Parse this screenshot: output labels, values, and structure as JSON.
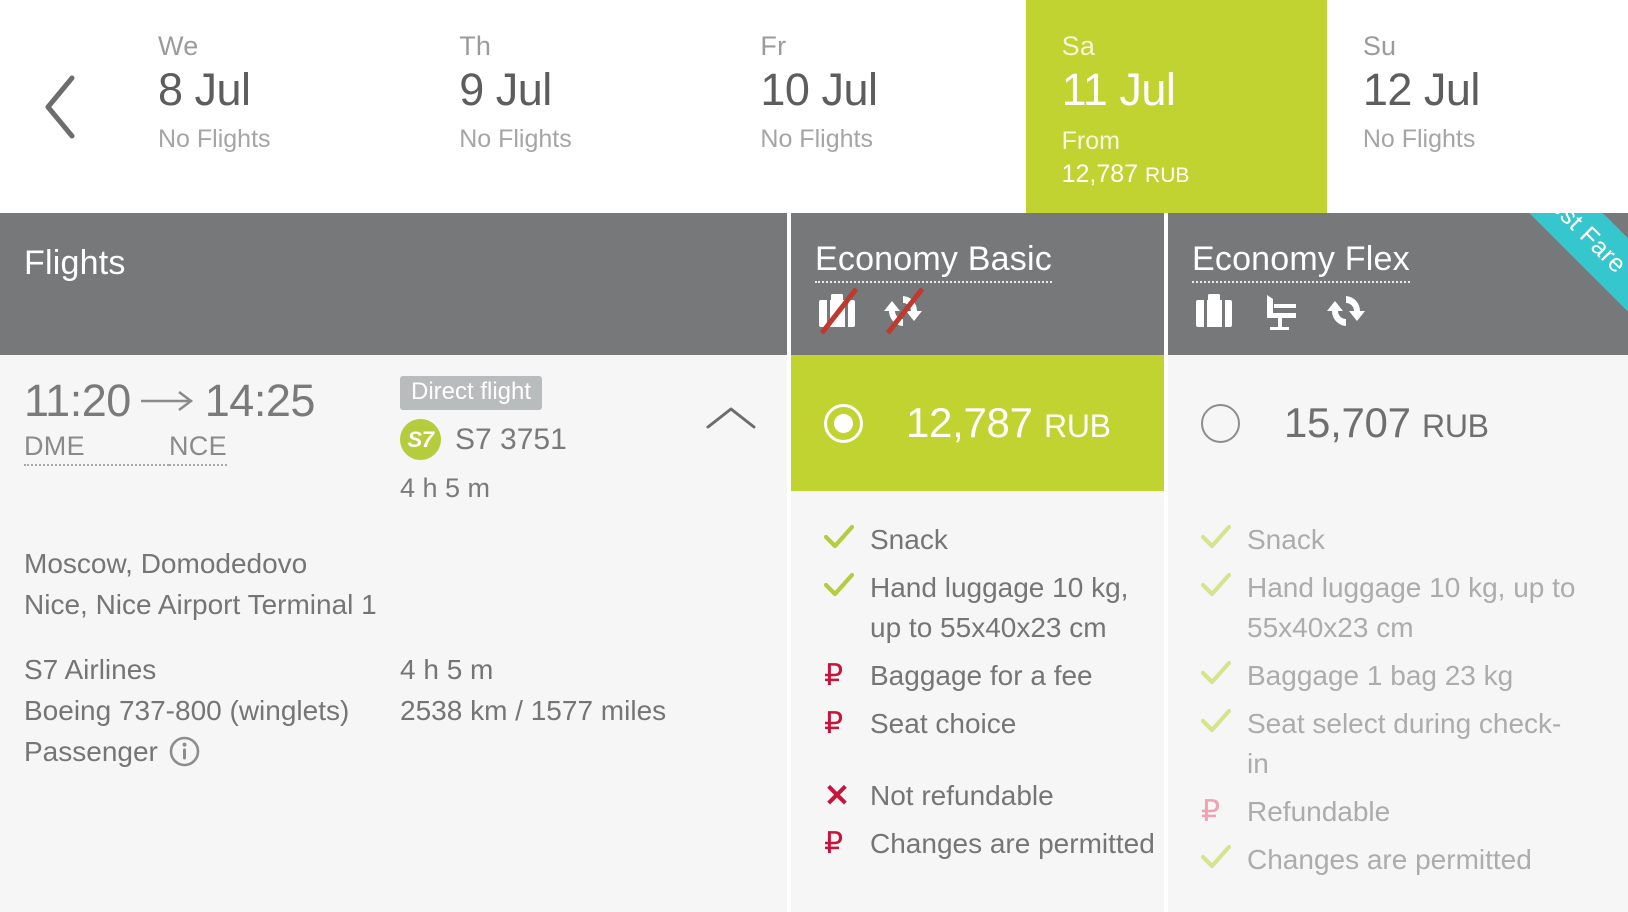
{
  "date_strip": {
    "prev_icon": "chevron-left-icon",
    "days": [
      {
        "dow": "We",
        "date": "8 Jul",
        "status": "No Flights",
        "selected": false
      },
      {
        "dow": "Th",
        "date": "9 Jul",
        "status": "No Flights",
        "selected": false
      },
      {
        "dow": "Fr",
        "date": "10 Jul",
        "status": "No Flights",
        "selected": false
      },
      {
        "dow": "Sa",
        "date": "11 Jul",
        "from_label": "From",
        "price": "12,787",
        "currency": "RUB",
        "selected": true
      },
      {
        "dow": "Su",
        "date": "12 Jul",
        "status": "No Flights",
        "selected": false
      }
    ]
  },
  "table_header": {
    "flights_label": "Flights",
    "fares": [
      {
        "name": "Economy Basic",
        "icons": [
          {
            "name": "suitcase-icon",
            "crossed": true
          },
          {
            "name": "exchange-refresh-icon",
            "crossed": true
          }
        ],
        "ribbon": null
      },
      {
        "name": "Economy Flex",
        "icons": [
          {
            "name": "suitcase-icon",
            "crossed": false
          },
          {
            "name": "seat-icon",
            "crossed": false
          },
          {
            "name": "exchange-refresh-icon",
            "crossed": false
          }
        ],
        "ribbon": "Best Fare"
      }
    ]
  },
  "flight": {
    "depart_time": "11:20",
    "arrive_time": "14:25",
    "depart_code": "DME",
    "arrive_code": "NCE",
    "direct_badge": "Direct flight",
    "carrier_logo_text": "S7",
    "flight_number": "S7 3751",
    "duration_short": "4 h 5 m",
    "collapse_icon": "chevron-up-icon",
    "origin_full": "Moscow, Domodedovo",
    "destination_full": "Nice, Nice Airport Terminal 1",
    "airline": "S7 Airlines",
    "duration": "4 h 5 m",
    "aircraft": "Boeing 737-800 (winglets)",
    "distance": "2538 km / 1577 miles",
    "passenger_label": "Passenger",
    "passenger_info_icon": "info-icon"
  },
  "fare_options": [
    {
      "id": "economy-basic",
      "price": "12,787",
      "currency": "RUB",
      "selected": true,
      "features": [
        {
          "icon": "check",
          "text": "Snack",
          "group": 1
        },
        {
          "icon": "check",
          "text": "Hand luggage 10 kg, up to 55x40x23 cm",
          "group": 1
        },
        {
          "icon": "rub",
          "text": "Baggage for a fee",
          "group": 1
        },
        {
          "icon": "rub",
          "text": "Seat choice",
          "group": 1
        },
        {
          "icon": "cross",
          "text": "Not refundable",
          "group": 2
        },
        {
          "icon": "rub",
          "text": "Changes are permitted",
          "group": 2
        }
      ]
    },
    {
      "id": "economy-flex",
      "price": "15,707",
      "currency": "RUB",
      "selected": false,
      "features": [
        {
          "icon": "check",
          "text": "Snack",
          "group": 1
        },
        {
          "icon": "check",
          "text": "Hand luggage 10 kg, up to 55x40x23 cm",
          "group": 1
        },
        {
          "icon": "check",
          "text": "Baggage 1 bag 23 kg",
          "group": 1
        },
        {
          "icon": "check",
          "text": "Seat select during check-in",
          "group": 1
        },
        {
          "icon": "rub",
          "text": "Refundable",
          "group": 2
        },
        {
          "icon": "check",
          "text": "Changes are permitted",
          "group": 2
        }
      ]
    }
  ],
  "colors": {
    "accent_green": "#c0d330",
    "header_gray": "#76787a",
    "ribbon_teal": "#36c6cd",
    "rub_red": "#c8143c",
    "cross_red": "#c0392f"
  }
}
